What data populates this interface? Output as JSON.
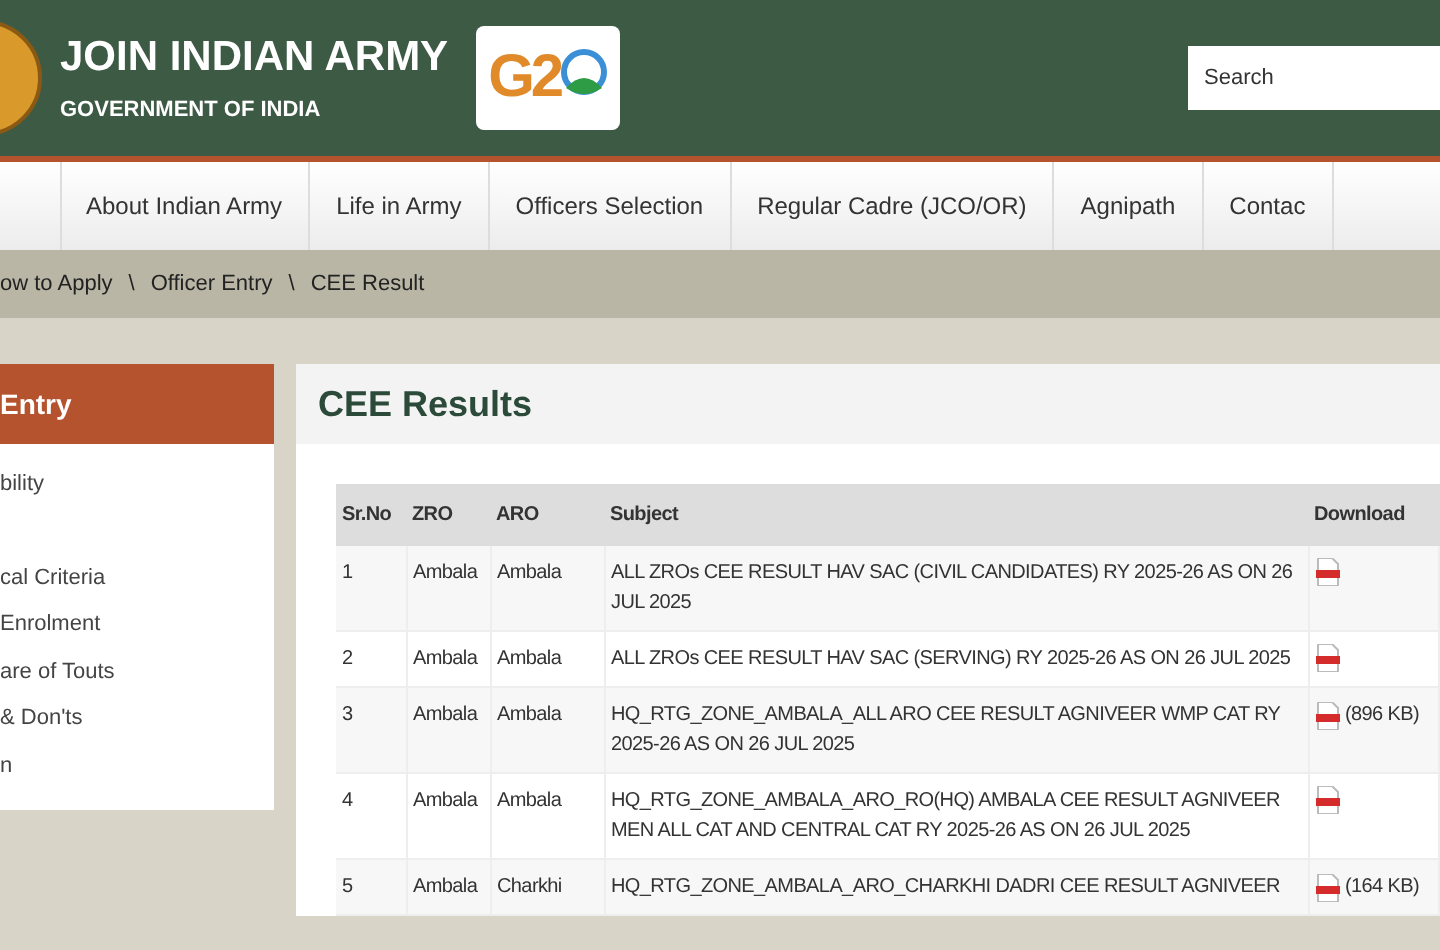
{
  "header": {
    "title": "JOIN INDIAN ARMY",
    "subtitle": "GOVERNMENT OF INDIA",
    "logo_text": "G2",
    "search": {
      "placeholder": "Search"
    }
  },
  "nav": [
    {
      "label": "About Indian Army",
      "selected": false
    },
    {
      "label": "Life in Army",
      "selected": false
    },
    {
      "label": "Officers Selection",
      "selected": false
    },
    {
      "label": "Regular Cadre (JCO/OR)",
      "selected": false
    },
    {
      "label": "Agnipath",
      "selected": false
    },
    {
      "label": "Contac",
      "selected": false
    }
  ],
  "breadcrumb": {
    "links": [
      "ow to Apply",
      "Officer Entry",
      "CEE Result"
    ],
    "separator": "\\"
  },
  "sidebar": {
    "title": "Entry",
    "items": [
      "bility",
      "cal Criteria",
      "Enrolment",
      "are of Touts",
      "& Don'ts",
      "n"
    ]
  },
  "content": {
    "title": "CEE Results",
    "table": {
      "columns": [
        "Sr.No",
        "ZRO",
        "ARO",
        "Subject",
        "Download"
      ],
      "rows": [
        {
          "sr": "1",
          "zro": "Ambala",
          "aro": "Ambala",
          "subject": "ALL ZROs CEE RESULT HAV SAC (CIVIL CANDIDATES) RY 2025-26 AS ON 26 JUL 2025",
          "size": ""
        },
        {
          "sr": "2",
          "zro": "Ambala",
          "aro": "Ambala",
          "subject": "ALL ZROs CEE RESULT HAV SAC (SERVING) RY 2025-26 AS ON 26 JUL 2025",
          "size": ""
        },
        {
          "sr": "3",
          "zro": "Ambala",
          "aro": "Ambala",
          "subject": "HQ_RTG_ZONE_AMBALA_ALL ARO CEE RESULT AGNIVEER WMP CAT RY 2025-26 AS ON 26 JUL 2025",
          "size": "(896 KB)"
        },
        {
          "sr": "4",
          "zro": "Ambala",
          "aro": "Ambala",
          "subject": "HQ_RTG_ZONE_AMBALA_ARO_RO(HQ) AMBALA CEE RESULT AGNIVEER MEN ALL CAT AND CENTRAL CAT RY 2025-26 AS ON 26 JUL 2025",
          "size": ""
        },
        {
          "sr": "5",
          "zro": "Ambala",
          "aro": "Charkhi",
          "subject": "HQ_RTG_ZONE_AMBALA_ARO_CHARKHI DADRI CEE RESULT AGNIVEER",
          "size": "(164 KB)"
        }
      ]
    }
  }
}
